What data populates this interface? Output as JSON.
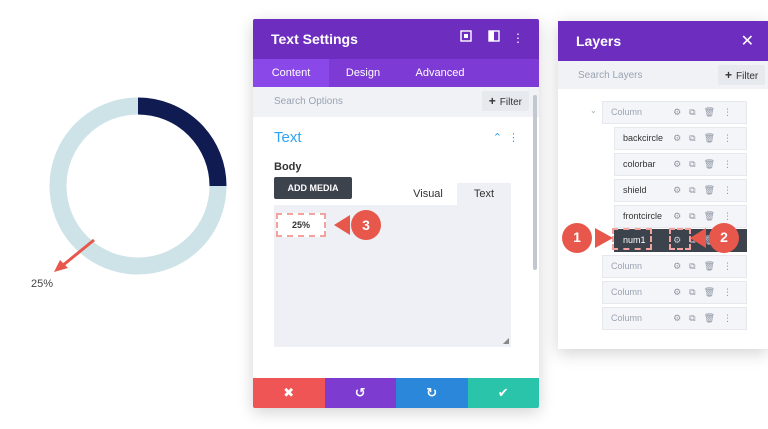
{
  "preview": {
    "donut_value_label": "25%",
    "donut_fraction": 0.25,
    "colors": {
      "ring": "#cde3e8",
      "progress": "#101b52",
      "arrow": "#e8574b"
    }
  },
  "settings_modal": {
    "title": "Text Settings",
    "header_icons": [
      "fullscreen-icon",
      "split-view-icon",
      "more-vertical-icon"
    ],
    "tabs": [
      {
        "label": "Content",
        "active": true
      },
      {
        "label": "Design",
        "active": false
      },
      {
        "label": "Advanced",
        "active": false
      }
    ],
    "search_placeholder": "Search Options",
    "filter_label": "Filter",
    "section_title": "Text",
    "body_label": "Body",
    "add_media_label": "ADD MEDIA",
    "editor_tabs": {
      "visual": "Visual",
      "text": "Text"
    },
    "editor_content": "25%",
    "footer_buttons": [
      "cancel-icon",
      "undo-icon",
      "redo-icon",
      "check-icon"
    ],
    "colors": {
      "header": "#6d2ec0",
      "accent": "#2ea3f2",
      "cancel": "#ef5555",
      "undo": "#7e3bd0",
      "redo": "#2b87da",
      "save": "#29c4a9"
    }
  },
  "layers_panel": {
    "title": "Layers",
    "search_placeholder": "Search Layers",
    "filter_label": "Filter",
    "rows": [
      {
        "label": "Column",
        "kind": "column"
      },
      {
        "label": "backcircle",
        "kind": "module"
      },
      {
        "label": "colorbar",
        "kind": "module"
      },
      {
        "label": "shield",
        "kind": "module"
      },
      {
        "label": "frontcircle",
        "kind": "module"
      },
      {
        "label": "num1",
        "kind": "module",
        "selected": true
      },
      {
        "label": "Column",
        "kind": "column"
      },
      {
        "label": "Column",
        "kind": "column"
      },
      {
        "label": "Column",
        "kind": "column"
      }
    ]
  },
  "callouts": [
    {
      "number": "1",
      "color": "#e8574b"
    },
    {
      "number": "2",
      "color": "#e8574b"
    },
    {
      "number": "3",
      "color": "#e8574b"
    }
  ]
}
